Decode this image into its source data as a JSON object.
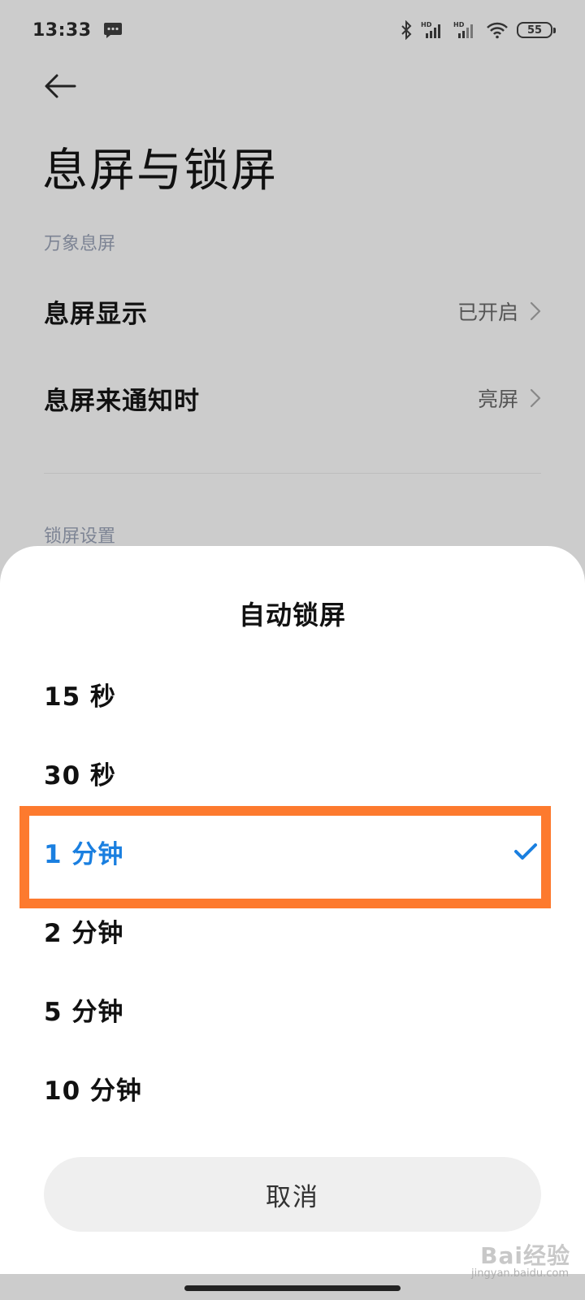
{
  "status_bar": {
    "time": "13:33",
    "battery": "55",
    "icons": [
      "message-icon",
      "bluetooth-icon",
      "hd-signal-icon",
      "hd-signal-icon",
      "wifi-icon",
      "battery-icon"
    ]
  },
  "header": {
    "back_icon": "arrow-left-icon",
    "title": "息屏与锁屏"
  },
  "sections": [
    {
      "label": "万象息屏",
      "items": [
        {
          "name": "息屏显示",
          "value": "已开启"
        },
        {
          "name": "息屏来通知时",
          "value": "亮屏"
        }
      ]
    },
    {
      "label": "锁屏设置"
    }
  ],
  "sheet": {
    "title": "自动锁屏",
    "options": [
      {
        "label": "15 秒",
        "selected": false
      },
      {
        "label": "30 秒",
        "selected": false
      },
      {
        "label": "1 分钟",
        "selected": true
      },
      {
        "label": "2 分钟",
        "selected": false
      },
      {
        "label": "5 分钟",
        "selected": false
      },
      {
        "label": "10 分钟",
        "selected": false
      }
    ],
    "cancel_label": "取消"
  },
  "colors": {
    "accent": "#1a7fe0",
    "highlight": "#fd7a2e",
    "overlay": "#cccccc"
  },
  "watermark": {
    "brand": "Bai经验",
    "sub": "jingyan.baidu.com"
  }
}
